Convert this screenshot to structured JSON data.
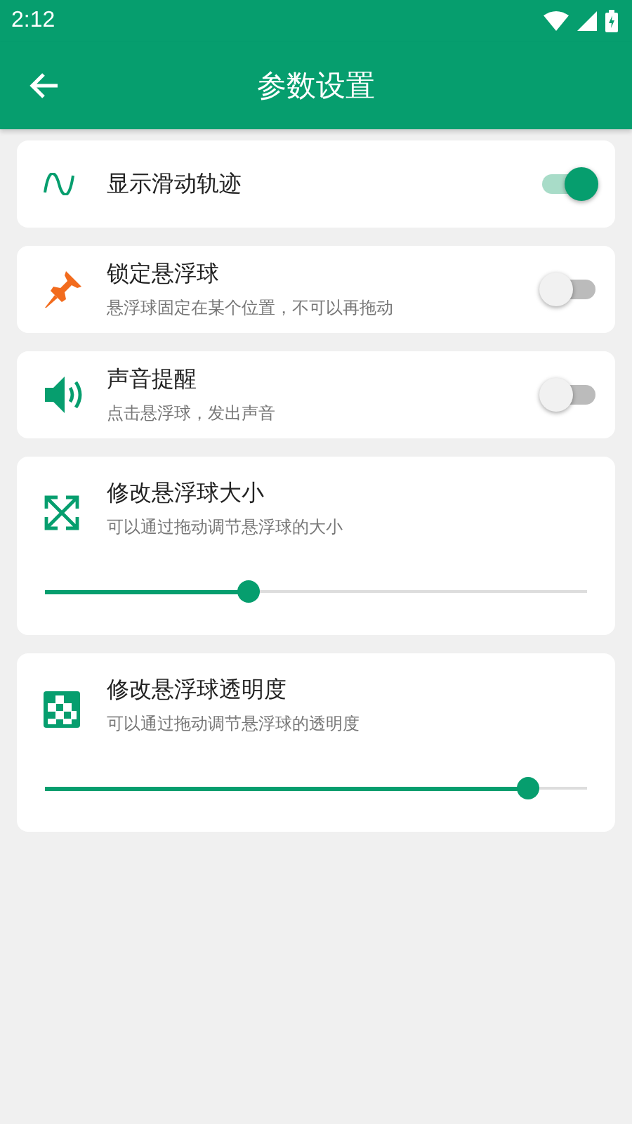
{
  "status_bar": {
    "time": "2:12"
  },
  "app_bar": {
    "title": "参数设置"
  },
  "settings": [
    {
      "kind": "switch",
      "title": "显示滑动轨迹",
      "on": true
    },
    {
      "kind": "switch",
      "title": "锁定悬浮球",
      "subtitle": "悬浮球固定在某个位置，不可以再拖动",
      "on": false
    },
    {
      "kind": "switch",
      "title": "声音提醒",
      "subtitle": "点击悬浮球，发出声音",
      "on": false
    },
    {
      "kind": "slider",
      "title": "修改悬浮球大小",
      "subtitle": "可以通过拖动调节悬浮球的大小",
      "level": 0.375
    },
    {
      "kind": "slider",
      "title": "修改悬浮球透明度",
      "subtitle": "可以通过拖动调节悬浮球的透明度",
      "level": 0.89
    }
  ]
}
